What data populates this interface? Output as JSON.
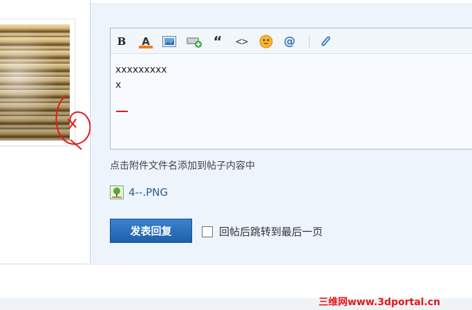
{
  "editor": {
    "toolbar": [
      {
        "name": "bold-icon",
        "label": "B"
      },
      {
        "name": "font-color-icon",
        "label": "A"
      },
      {
        "name": "image-icon"
      },
      {
        "name": "attach-image-icon"
      },
      {
        "name": "quote-icon",
        "label": "“"
      },
      {
        "name": "code-icon",
        "label": "<>"
      },
      {
        "name": "emoji-icon"
      },
      {
        "name": "mention-icon",
        "label": "@"
      },
      {
        "name": "attachment-clip-icon"
      }
    ],
    "content_lines": [
      "xxxxxxxxx",
      "x"
    ]
  },
  "hint": "点击附件文件名添加到帖子内容中",
  "attachment": {
    "filename": "4--.PNG"
  },
  "submit_label": "发表回复",
  "checkbox_label": "回帖后跳转到最后一页",
  "watermark": "三维网www.3dportal.cn",
  "colors": {
    "accent": "#1f64b0",
    "panel": "#edf4fc",
    "red": "#e21b1b"
  }
}
